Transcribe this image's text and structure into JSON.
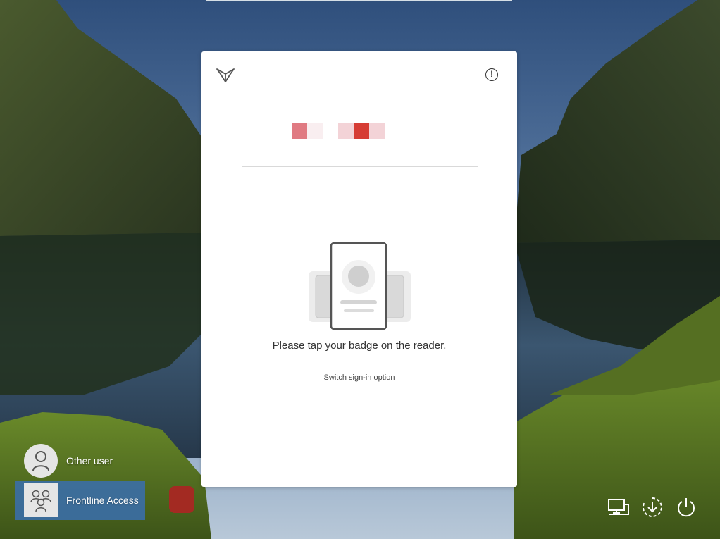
{
  "card": {
    "prompt": "Please tap your badge on the reader.",
    "switch_link": "Switch sign-in option",
    "info_icon": "!"
  },
  "users": [
    {
      "label": "Other user",
      "icon": "user-avatar-icon"
    },
    {
      "label": "Frontline Access",
      "icon": "group-avatar-icon"
    }
  ],
  "tray": {
    "network": "network-icon",
    "accessibility": "accessibility-icon",
    "power": "power-icon"
  },
  "colors": {
    "selected_user_bg": "#3a6eaf",
    "brand_red": "#d63c34",
    "brand_pink": "#f3d3d7"
  }
}
